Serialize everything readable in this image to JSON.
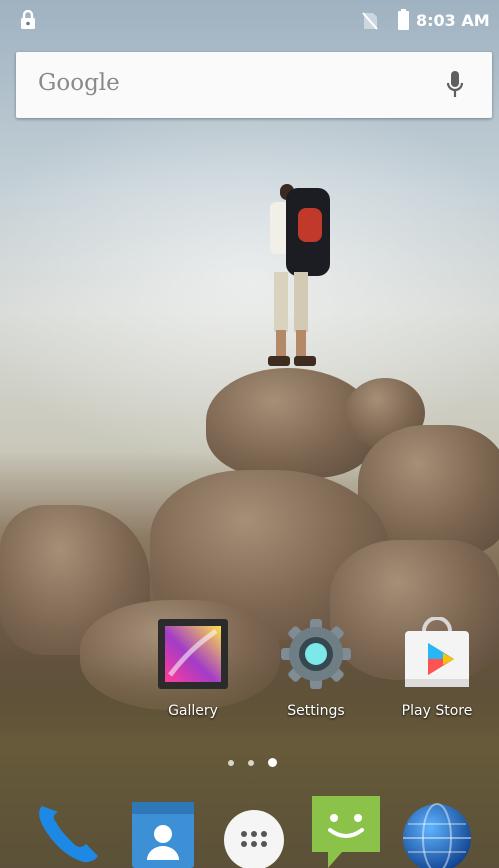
{
  "status_bar": {
    "time": "8:03 AM",
    "icons": [
      "lock-icon",
      "no-sim-icon",
      "battery-icon"
    ]
  },
  "search": {
    "placeholder": "Google",
    "icon": "mic-icon"
  },
  "apps": [
    {
      "label": "Gallery",
      "icon": "gallery-icon"
    },
    {
      "label": "Settings",
      "icon": "settings-icon"
    },
    {
      "label": "Play Store",
      "icon": "play-store-icon"
    }
  ],
  "page_indicator": {
    "pages": 3,
    "current": 3
  },
  "dock": [
    {
      "icon": "phone-icon"
    },
    {
      "icon": "contacts-icon"
    },
    {
      "icon": "app-drawer-icon"
    },
    {
      "icon": "messaging-icon"
    },
    {
      "icon": "browser-icon"
    }
  ],
  "colors": {
    "status_text": "#ffffff",
    "search_bg": "#fafafa",
    "search_text": "#8a8a8a",
    "phone_blue": "#1e88e5",
    "contacts_blue": "#3d8fd6",
    "messaging_green": "#8bc34a"
  }
}
